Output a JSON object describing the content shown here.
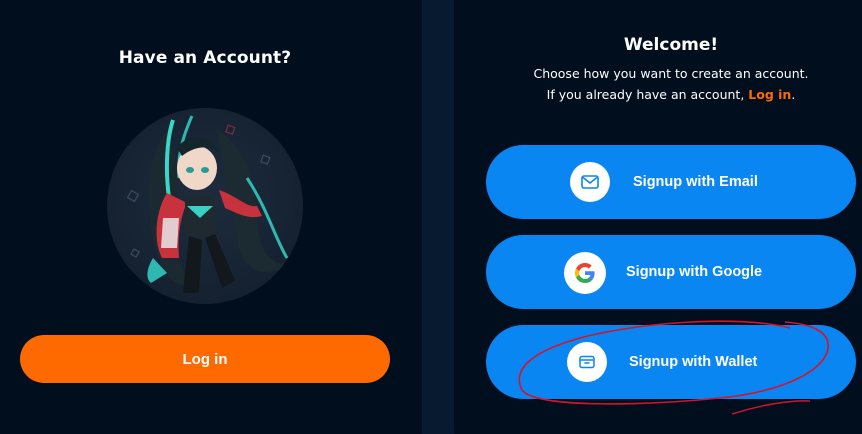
{
  "left_card": {
    "title": "Have an Account?",
    "login_button": "Log in"
  },
  "right_card": {
    "title": "Welcome!",
    "subtitle_line1": "Choose how you want to create an account.",
    "subtitle_line2_prefix": "If you already have an account, ",
    "subtitle_line2_link": "Log in",
    "subtitle_line2_suffix": ".",
    "buttons": [
      {
        "label": "Signup with Email",
        "icon": "mail-icon"
      },
      {
        "label": "Signup with Google",
        "icon": "google-icon"
      },
      {
        "label": "Signup with Wallet",
        "icon": "wallet-icon"
      }
    ]
  },
  "colors": {
    "background": "#071a30",
    "card": "#010e1e",
    "primary_orange": "#ff6a00",
    "primary_blue": "#0a86f2",
    "annotation_red": "#d4142a"
  }
}
